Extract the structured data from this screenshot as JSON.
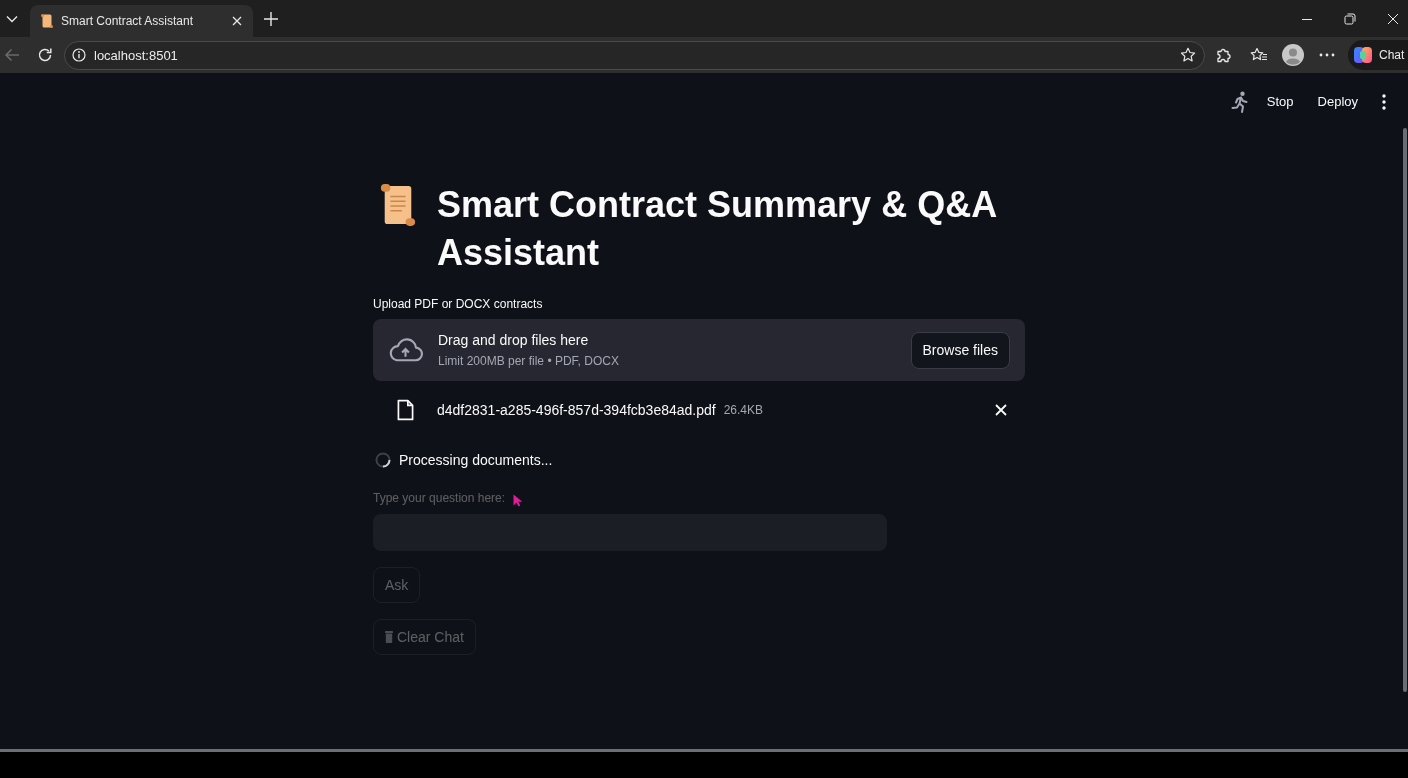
{
  "browser": {
    "tabs": [
      {
        "title": "Smart Contract Assistant",
        "selected": true
      }
    ],
    "back_disabled": true,
    "address": "localhost:8501",
    "chat_button": "Chat"
  },
  "app_toolbar": {
    "stop_button": "Stop",
    "deploy_button": "Deploy"
  },
  "page": {
    "title": "Smart Contract Summary & Q&A Assistant",
    "uploader": {
      "label": "Upload PDF or DOCX contracts",
      "dropzone_title": "Drag and drop files here",
      "dropzone_hint": "Limit 200MB per file • PDF, DOCX",
      "browse_button": "Browse files",
      "files": [
        {
          "name": "d4df2831-a285-496f-857d-394fcb3e84ad.pdf",
          "size": "26.4KB"
        }
      ]
    },
    "status": "Processing documents...",
    "question": {
      "label": "Type your question here:",
      "disabled": true
    },
    "buttons": [
      {
        "label": "Ask",
        "kind": "plain",
        "disabled": true
      },
      {
        "label": "Clear Chat",
        "kind": "delete",
        "disabled": true
      }
    ]
  }
}
